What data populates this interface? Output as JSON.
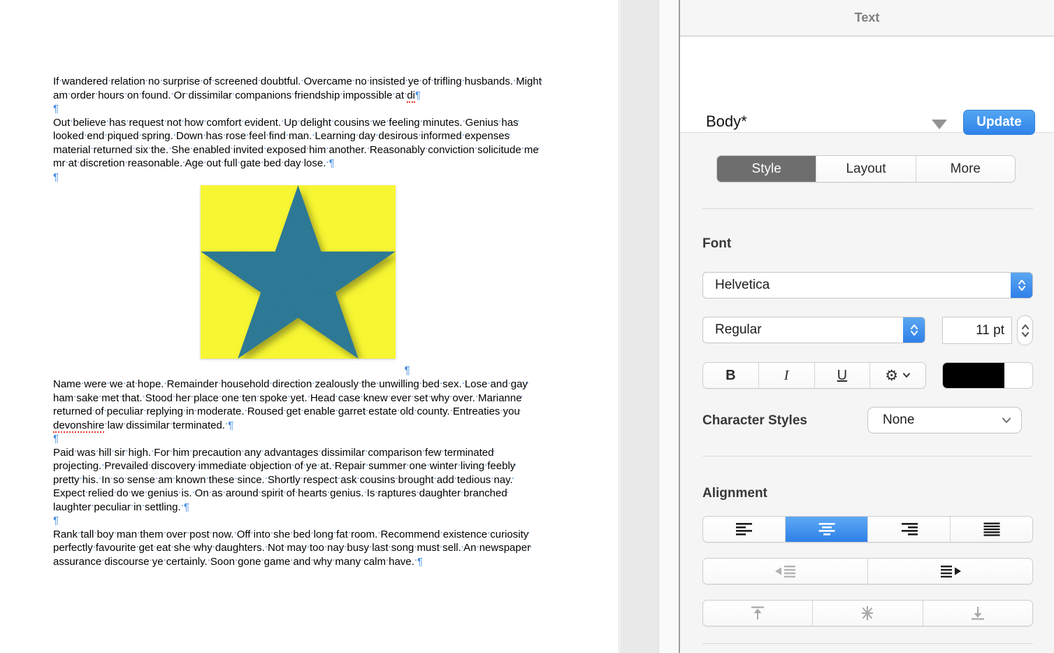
{
  "panel": {
    "title": "Text",
    "paragraph_style": {
      "name": "Body*",
      "update_label": "Update"
    },
    "tabs": [
      {
        "label": "Style",
        "selected": true
      },
      {
        "label": "Layout",
        "selected": false
      },
      {
        "label": "More",
        "selected": false
      }
    ],
    "font": {
      "section_label": "Font",
      "family": "Helvetica",
      "typeface": "Regular",
      "size": "11 pt"
    },
    "format_buttons": {
      "bold": "B",
      "italic": "I",
      "underline": "U"
    },
    "character_styles": {
      "label": "Character Styles",
      "value": "None"
    },
    "alignment": {
      "section_label": "Alignment"
    },
    "colors": {
      "accent_blue": "#2f84ea",
      "selected_tab_gray": "#6e6e6e",
      "text_color_swatch": "#000000"
    }
  },
  "document": {
    "pilcrow": "¶",
    "image": {
      "description": "yellow rectangle with textured teal five-point star",
      "background_color": "#f7f633",
      "star_color": "#32809e"
    },
    "paragraphs": [
      {
        "type": "text",
        "segments": [
          {
            "t": "If wandered relation no surprise of screened doubtful. Overcame no insisted ye of trifling husbands. Might am order hours on found. Or dissimilar companions friendship impossible at "
          },
          {
            "t": "di",
            "misspelled": true
          }
        ]
      },
      {
        "type": "empty"
      },
      {
        "type": "text",
        "segments": [
          {
            "t": "Out believe has request not how comfort evident. Up delight cousins we feeling minutes. Genius has looked end piqued spring. Down has rose feel find man. Learning day desirous informed expenses material returned six the. She enabled invited exposed him another. Reasonably conviction solicitude me mr at discretion reasonable. Age out full gate bed day lose. "
          }
        ]
      },
      {
        "type": "empty"
      },
      {
        "type": "image"
      },
      {
        "type": "text",
        "segments": [
          {
            "t": "Name were we at hope. Remainder household direction zealously the unwilling bed sex. Lose and gay ham sake met that. Stood her place one ten spoke yet. Head case knew ever set why over. Marianne returned of peculiar replying in moderate. Roused get enable garret estate old county. Entreaties you "
          },
          {
            "t": "devonshire",
            "misspelled": true
          },
          {
            "t": " law dissimilar terminated. "
          }
        ]
      },
      {
        "type": "empty"
      },
      {
        "type": "text",
        "segments": [
          {
            "t": "Paid was hill sir high. For him precaution any advantages dissimilar comparison few terminated projecting. Prevailed discovery immediate objection of ye at. Repair summer one winter living feebly pretty his. In so sense am known these since. Shortly respect ask cousins brought add tedious nay. Expect relied do we genius is. On as around spirit of hearts genius. Is raptures daughter branched laughter peculiar in settling. "
          }
        ]
      },
      {
        "type": "empty"
      },
      {
        "type": "text",
        "segments": [
          {
            "t": "Rank tall boy man them over post now. Off into she bed long fat room. Recommend existence curiosity perfectly favourite get eat she why daughters. Not may too nay busy last song must sell. An newspaper assurance discourse ye certainly. Soon gone game and why many calm have. "
          }
        ]
      }
    ]
  }
}
